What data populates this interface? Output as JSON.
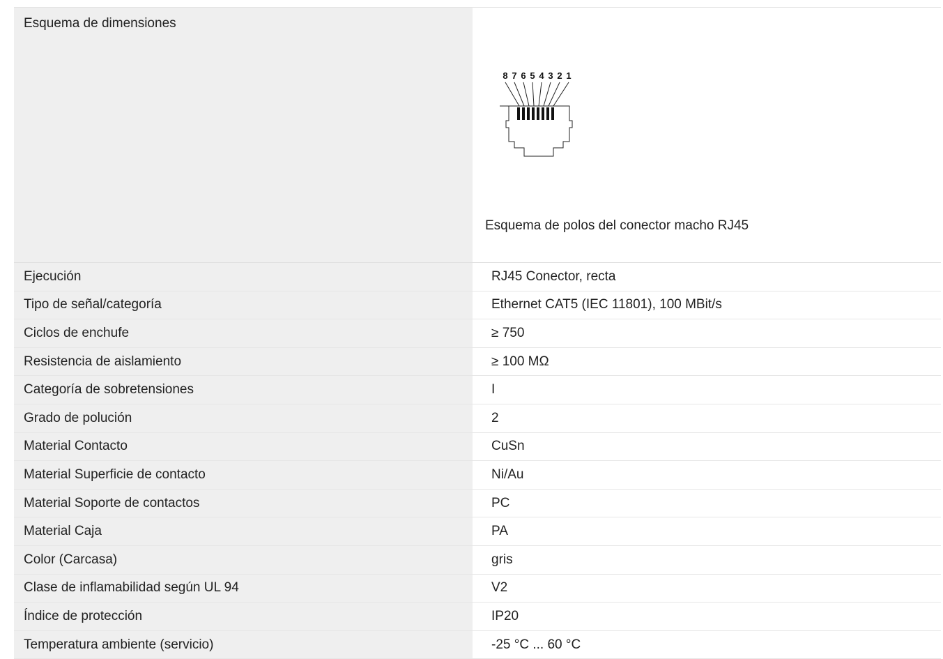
{
  "diagram": {
    "label": "Esquema de dimensiones",
    "caption": "Esquema de polos del conector macho RJ45",
    "pin_numbers": [
      "8",
      "7",
      "6",
      "5",
      "4",
      "3",
      "2",
      "1"
    ]
  },
  "rows": [
    {
      "label": "Ejecución",
      "value": "RJ45 Conector, recta"
    },
    {
      "label": "Tipo de señal/categoría",
      "value": "Ethernet CAT5 (IEC 11801), 100 MBit/s"
    },
    {
      "label": "Ciclos de enchufe",
      "value": "≥ 750"
    },
    {
      "label": "Resistencia de aislamiento",
      "value": "≥ 100 MΩ"
    },
    {
      "label": "Categoría de sobretensiones",
      "value": "I"
    },
    {
      "label": "Grado de polución",
      "value": "2"
    },
    {
      "label": "Material Contacto",
      "value": "CuSn"
    },
    {
      "label": "Material Superficie de contacto",
      "value": "Ni/Au"
    },
    {
      "label": "Material Soporte de contactos",
      "value": "PC"
    },
    {
      "label": "Material Caja",
      "value": "PA"
    },
    {
      "label": "Color (Carcasa)",
      "value": "gris"
    },
    {
      "label": "Clase de inflamabilidad según UL 94",
      "value": "V2"
    },
    {
      "label": "Índice de protección",
      "value": "IP20"
    },
    {
      "label": "Temperatura ambiente (servicio)",
      "value": "-25 °C ... 60 °C"
    }
  ]
}
